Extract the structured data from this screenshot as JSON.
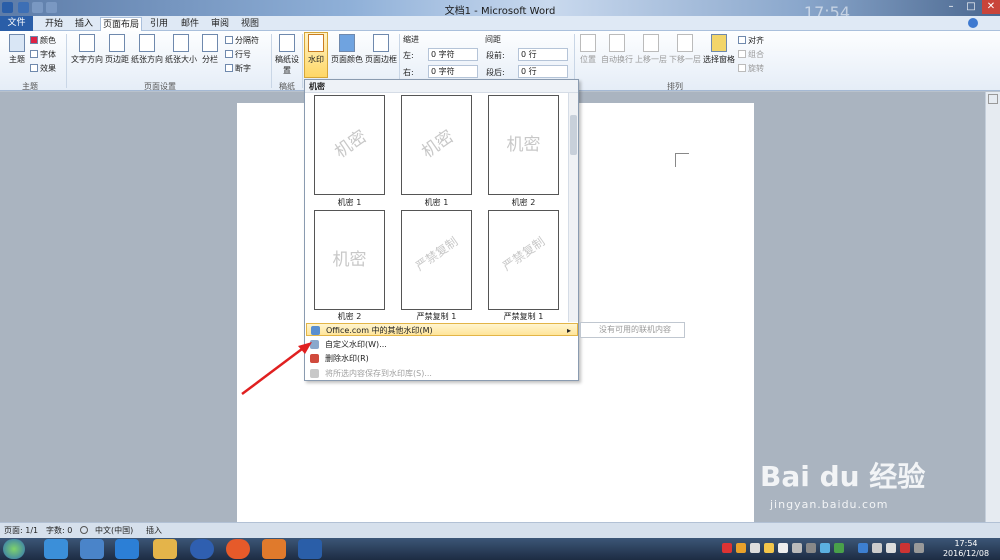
{
  "window": {
    "title": "文档1 - Microsoft Word",
    "clock_ghost": "17:54"
  },
  "tabs": [
    {
      "label": "文件"
    },
    {
      "label": "开始"
    },
    {
      "label": "插入"
    },
    {
      "label": "页面布局"
    },
    {
      "label": "引用"
    },
    {
      "label": "邮件"
    },
    {
      "label": "审阅"
    },
    {
      "label": "视图"
    }
  ],
  "ribbon": {
    "theme": {
      "btn": "主题",
      "colors": "颜色",
      "fonts": "字体",
      "effects": "效果",
      "group": "主题"
    },
    "page_setup": {
      "text_dir": "文字方向",
      "margins": "页边距",
      "orientation": "纸张方向",
      "size": "纸张大小",
      "columns": "分栏",
      "breaks": "分隔符",
      "line_numbers": "行号",
      "hyphenation": "断字",
      "group": "页面设置"
    },
    "draft": {
      "btn": "稿纸设置",
      "group": "稿纸"
    },
    "page_bg": {
      "watermark": "水印",
      "page_color": "页面颜色",
      "page_border": "页面边框"
    },
    "paragraph": {
      "indent": "缩进",
      "left": "左:",
      "left_val": "0 字符",
      "right": "右:",
      "right_val": "0 字符",
      "spacing": "间距",
      "before": "段前:",
      "before_val": "0 行",
      "after": "段后:",
      "after_val": "0 行"
    },
    "arrange": {
      "position": "位置",
      "wrap": "自动换行",
      "forward": "上移一层",
      "backward": "下移一层",
      "selection": "选择窗格",
      "align": "对齐",
      "group_btn": "组合",
      "rotate": "旋转",
      "group": "排列"
    }
  },
  "dropdown": {
    "header": "机密",
    "thumbs": [
      {
        "wm": "机密",
        "caption": "机密 1"
      },
      {
        "wm": "机密",
        "caption": "机密 1"
      },
      {
        "wm": "机密",
        "caption": "机密 2"
      },
      {
        "wm": "机密",
        "caption": "机密 2"
      },
      {
        "wm": "严禁复制",
        "caption": "严禁复制 1"
      },
      {
        "wm": "严禁复制",
        "caption": "严禁复制 1"
      }
    ],
    "menu": [
      {
        "label": "Office.com 中的其他水印(M)"
      },
      {
        "label": "自定义水印(W)..."
      },
      {
        "label": "删除水印(R)"
      },
      {
        "label": "将所选内容保存到水印库(S)..."
      }
    ],
    "submenu": "没有可用的联机内容"
  },
  "status": {
    "page": "页面: 1/1",
    "words": "字数: 0",
    "lang": "中文(中国)",
    "mode": "插入"
  },
  "taskbar": {
    "time": "17:54",
    "date": "2016/12/08"
  },
  "watermark_site": {
    "logo": "Bai du 经验",
    "url": "jingyan.baidu.com"
  }
}
